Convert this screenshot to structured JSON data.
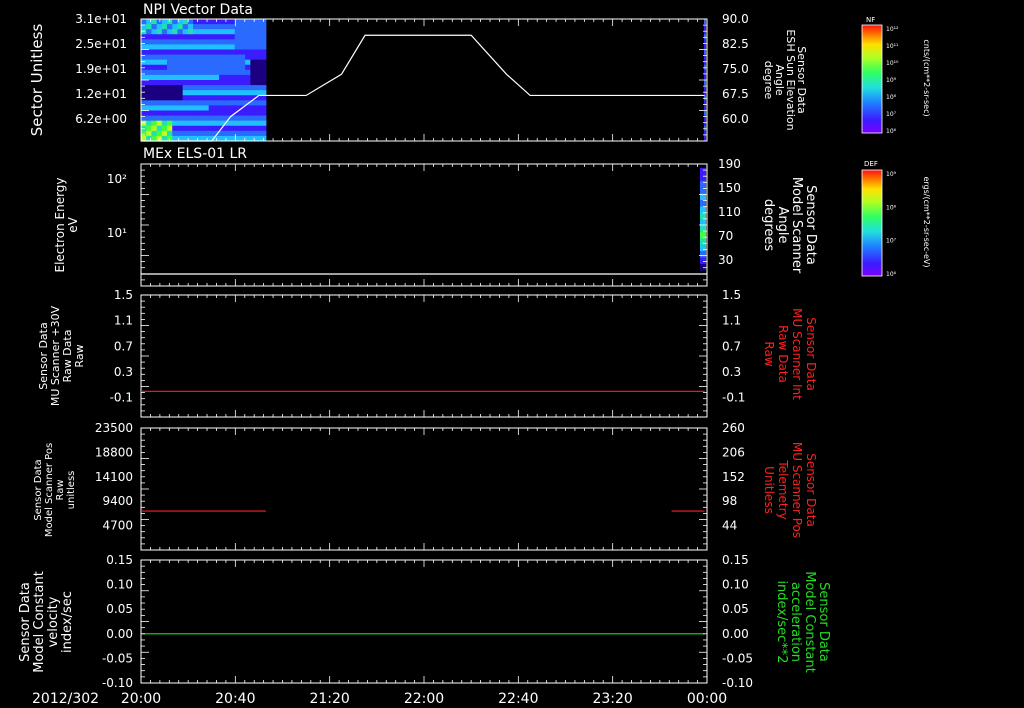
{
  "footer": {
    "date": "2012/302",
    "time_ticks": [
      "20:00",
      "20:40",
      "21:20",
      "22:00",
      "22:40",
      "23:20",
      "00:00"
    ]
  },
  "colors": {
    "white": "#ffffff",
    "red": "#ff2020",
    "green": "#22dd22",
    "spectro": [
      "#1a0080",
      "#3a1cff",
      "#2a6aff",
      "#20c0ff",
      "#20e0b0",
      "#40ff40",
      "#c0ff20",
      "#ffd000",
      "#ff6000",
      "#ff1010"
    ]
  },
  "chart_data": [
    {
      "type": "heatmap",
      "title": "NPI Vector Data",
      "ylabel": "Sector Unitless",
      "y_ticks_left": [
        "3.1e+01",
        "2.5e+01",
        "1.9e+01",
        "1.2e+01",
        "6.2e+00"
      ],
      "ylabel_right": [
        "Sensor Data",
        "ESH Sun Elevation",
        "Angle",
        "degree"
      ],
      "y_ticks_right": [
        "90.0",
        "82.5",
        "75.0",
        "67.5",
        "60.0"
      ],
      "overlay_line": {
        "name": "ESH Sun Elevation Angle",
        "x": [
          "20:00",
          "20:30",
          "20:38",
          "20:50",
          "21:00",
          "21:10",
          "21:25",
          "21:35",
          "22:10",
          "22:20",
          "22:35",
          "22:45",
          "23:59"
        ],
        "y": [
          52.5,
          52.5,
          60.0,
          66.5,
          66.5,
          66.5,
          73.0,
          85.0,
          85.0,
          85.0,
          73.0,
          66.5,
          66.5
        ]
      },
      "colorbar": {
        "label": "NF",
        "unit": "cnts/(cm**2-sr-sec)",
        "ticks": [
          "10¹²",
          "10¹¹",
          "10¹⁰",
          "10⁹",
          "10⁸",
          "10⁷",
          "10⁶"
        ]
      }
    },
    {
      "type": "heatmap",
      "title": "MEx ELS-01 LR",
      "ylabel": [
        "Electron Energy",
        "eV"
      ],
      "y_ticks_left": [
        "10²",
        "10¹"
      ],
      "ylabel_right": [
        "Sensor Data",
        "Model Scanner",
        "Angle",
        "degrees"
      ],
      "y_ticks_right": [
        "190",
        "150",
        "110",
        "70",
        "30"
      ],
      "overlay_line": {
        "name": "Model Scanner Angle",
        "x": [
          "20:00",
          "23:59"
        ],
        "y": [
          4,
          4
        ]
      },
      "colorbar": {
        "label": "DEF",
        "unit": "ergs/(cm**2-sr-sec-eV)",
        "ticks": [
          "10⁹",
          "10⁸",
          "10⁷",
          "10⁶"
        ]
      }
    },
    {
      "type": "line",
      "ylabel": [
        "Sensor Data",
        "MU Scanner +30V",
        "Raw Data",
        "Raw"
      ],
      "y_ticks_left": [
        "1.5",
        "1.1",
        "0.7",
        "0.3",
        "-0.1"
      ],
      "ylabel_right": [
        "Sensor Data",
        "MU Scanner Int",
        "Raw Data",
        "Raw"
      ],
      "y_ticks_right": [
        "1.5",
        "1.1",
        "0.7",
        "0.3",
        "-0.1"
      ],
      "ylim": [
        -0.4,
        1.5
      ],
      "series": [
        {
          "x": [
            "20:00",
            "23:59"
          ],
          "values": [
            0.0,
            0.0
          ]
        }
      ]
    },
    {
      "type": "line",
      "ylabel": [
        "Sensor Data",
        "Model Scanner Pos",
        "Raw",
        "unitless"
      ],
      "y_ticks_left": [
        "23500",
        "18800",
        "14100",
        "9400",
        "4700"
      ],
      "ylabel_right": [
        "Sensor Data",
        "MU Scanner Pos",
        "Telemetry",
        "Unitless"
      ],
      "y_ticks_right": [
        "260",
        "206",
        "152",
        "98",
        "44"
      ],
      "ylim": [
        0,
        23500
      ],
      "series": [
        {
          "x": [
            "20:00",
            "20:53"
          ],
          "values": [
            7500,
            7500
          ]
        },
        {
          "x": [
            "23:45",
            "23:59"
          ],
          "values": [
            7500,
            7500
          ]
        }
      ]
    },
    {
      "type": "line",
      "ylabel": [
        "Sensor Data",
        "Model Constant",
        "velocity",
        "index/sec"
      ],
      "y_ticks_left": [
        "0.15",
        "0.10",
        "0.05",
        "0.00",
        "-0.05",
        "-0.10"
      ],
      "ylabel_right": [
        "Sensor Data",
        "Model Constant",
        "acceleration",
        "index/sec**2"
      ],
      "y_ticks_right": [
        "0.15",
        "0.10",
        "0.05",
        "0.00",
        "-0.05",
        "-0.10"
      ],
      "ylim": [
        -0.1,
        0.15
      ],
      "series": [
        {
          "x": [
            "20:00",
            "23:59"
          ],
          "values": [
            0.0,
            0.0
          ]
        }
      ]
    }
  ]
}
